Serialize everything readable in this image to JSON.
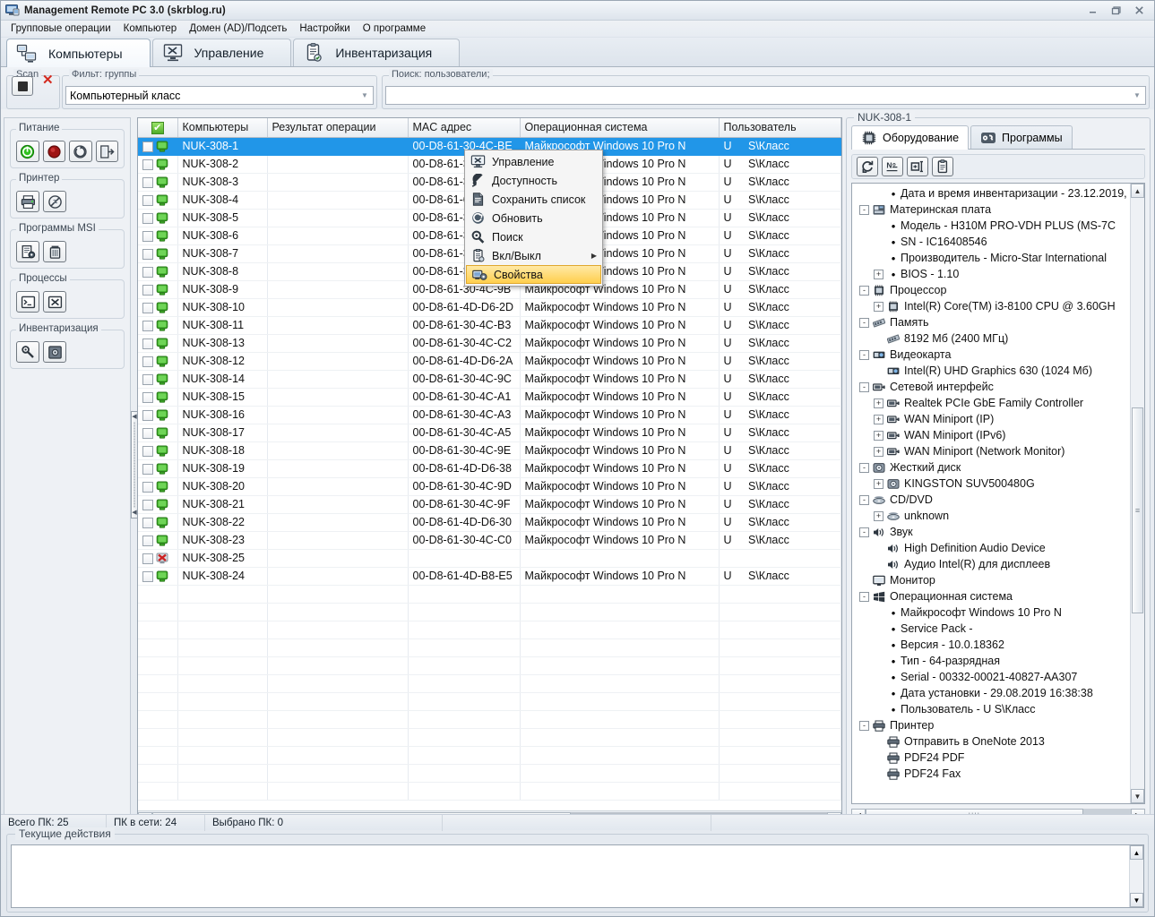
{
  "window": {
    "title": "Management Remote PC 3.0 (skrblog.ru)",
    "minimize": "–",
    "maximize": "❐",
    "close": "✕"
  },
  "menubar": [
    "Групповые операции",
    "Компьютер",
    "Домен (AD)/Подсеть",
    "Настройки",
    "О программе"
  ],
  "tabs": [
    {
      "label": "Компьютеры",
      "icon": "computers-icon",
      "active": true
    },
    {
      "label": "Управление",
      "icon": "management-icon",
      "active": false
    },
    {
      "label": "Инвентаризация",
      "icon": "inventory-icon",
      "active": false
    }
  ],
  "filterbar": {
    "scan_legend": "Scan",
    "filter_legend": "Фильт: группы",
    "filter_value": "Компьютерный класс",
    "search_legend": "Поиск: пользователи;",
    "search_value": ""
  },
  "lefttools": [
    {
      "legend": "Питание",
      "buttons": [
        {
          "name": "power-on-button",
          "icon": "power-green"
        },
        {
          "name": "power-off-button",
          "icon": "power-red"
        },
        {
          "name": "restart-button",
          "icon": "restart"
        },
        {
          "name": "logoff-button",
          "icon": "logoff"
        }
      ]
    },
    {
      "legend": "Принтер",
      "buttons": [
        {
          "name": "printer-add-button",
          "icon": "printer"
        },
        {
          "name": "printer-remove-button",
          "icon": "printer-block"
        }
      ]
    },
    {
      "legend": "Программы MSI",
      "buttons": [
        {
          "name": "msi-install-button",
          "icon": "msi-install"
        },
        {
          "name": "msi-uninstall-button",
          "icon": "trash"
        }
      ]
    },
    {
      "legend": "Процессы",
      "buttons": [
        {
          "name": "process-start-button",
          "icon": "console"
        },
        {
          "name": "process-kill-button",
          "icon": "console-kill"
        }
      ]
    },
    {
      "legend": "Инвентаризация",
      "buttons": [
        {
          "name": "inventory-scan-button",
          "icon": "wrench"
        },
        {
          "name": "inventory-save-button",
          "icon": "disk"
        }
      ]
    }
  ],
  "table": {
    "headers": [
      "",
      "Компьютеры",
      "Результат операции",
      "MAC адрес",
      "Операционная система",
      "Пользователь",
      ""
    ],
    "rows": [
      {
        "name": "NUK-308-1",
        "result": "",
        "mac": "00-D8-61-30-4C-BE",
        "os": "Майкрософт Windows 10 Pro N",
        "user": "U",
        "domain": "S\\Класс",
        "state": "on",
        "selected": true
      },
      {
        "name": "NUK-308-2",
        "result": "",
        "mac": "00-D8-61-30-4C-B1",
        "os": "Майкрософт Windows 10 Pro N",
        "user": "U",
        "domain": "S\\Класс",
        "state": "on",
        "selected": false
      },
      {
        "name": "NUK-308-3",
        "result": "",
        "mac": "00-D8-61-30-4C-A7",
        "os": "Майкрософт Windows 10 Pro N",
        "user": "U",
        "domain": "S\\Класс",
        "state": "on",
        "selected": false
      },
      {
        "name": "NUK-308-4",
        "result": "",
        "mac": "00-D8-61-61-4D-C4",
        "os": "Майкрософт Windows 10 Pro N",
        "user": "U",
        "domain": "S\\Класс",
        "state": "on",
        "selected": false
      },
      {
        "name": "NUK-308-5",
        "result": "",
        "mac": "00-D8-61-30-4C-A9",
        "os": "Майкрософт Windows 10 Pro N",
        "user": "U",
        "domain": "S\\Класс",
        "state": "on",
        "selected": false
      },
      {
        "name": "NUK-308-6",
        "result": "",
        "mac": "00-D8-61-30-4C-C1",
        "os": "Майкрософт Windows 10 Pro N",
        "user": "U",
        "domain": "S\\Класс",
        "state": "on",
        "selected": false
      },
      {
        "name": "NUK-308-7",
        "result": "",
        "mac": "00-D8-61-30-4C-B7",
        "os": "Майкрософт Windows 10 Pro N",
        "user": "U",
        "domain": "S\\Класс",
        "state": "on",
        "selected": false
      },
      {
        "name": "NUK-308-8",
        "result": "",
        "mac": "00-D8-61-30-4C-AD",
        "os": "Майкрософт Windows 10 Pro N",
        "user": "U",
        "domain": "S\\Класс",
        "state": "on",
        "selected": false
      },
      {
        "name": "NUK-308-9",
        "result": "",
        "mac": "00-D8-61-30-4C-9B",
        "os": "Майкрософт Windows 10 Pro N",
        "user": "U",
        "domain": "S\\Класс",
        "state": "on",
        "selected": false
      },
      {
        "name": "NUK-308-10",
        "result": "",
        "mac": "00-D8-61-4D-D6-2D",
        "os": "Майкрософт Windows 10 Pro N",
        "user": "U",
        "domain": "S\\Класс",
        "state": "on",
        "selected": false
      },
      {
        "name": "NUK-308-11",
        "result": "",
        "mac": "00-D8-61-30-4C-B3",
        "os": "Майкрософт Windows 10 Pro N",
        "user": "U",
        "domain": "S\\Класс",
        "state": "on",
        "selected": false
      },
      {
        "name": "NUK-308-13",
        "result": "",
        "mac": "00-D8-61-30-4C-C2",
        "os": "Майкрософт Windows 10 Pro N",
        "user": "U",
        "domain": "S\\Класс",
        "state": "on",
        "selected": false
      },
      {
        "name": "NUK-308-12",
        "result": "",
        "mac": "00-D8-61-4D-D6-2A",
        "os": "Майкрософт Windows 10 Pro N",
        "user": "U",
        "domain": "S\\Класс",
        "state": "on",
        "selected": false
      },
      {
        "name": "NUK-308-14",
        "result": "",
        "mac": "00-D8-61-30-4C-9C",
        "os": "Майкрософт Windows 10 Pro N",
        "user": "U",
        "domain": "S\\Класс",
        "state": "on",
        "selected": false
      },
      {
        "name": "NUK-308-15",
        "result": "",
        "mac": "00-D8-61-30-4C-A1",
        "os": "Майкрософт Windows 10 Pro N",
        "user": "U",
        "domain": "S\\Класс",
        "state": "on",
        "selected": false
      },
      {
        "name": "NUK-308-16",
        "result": "",
        "mac": "00-D8-61-30-4C-A3",
        "os": "Майкрософт Windows 10 Pro N",
        "user": "U",
        "domain": "S\\Класс",
        "state": "on",
        "selected": false
      },
      {
        "name": "NUK-308-17",
        "result": "",
        "mac": "00-D8-61-30-4C-A5",
        "os": "Майкрософт Windows 10 Pro N",
        "user": "U",
        "domain": "S\\Класс",
        "state": "on",
        "selected": false
      },
      {
        "name": "NUK-308-18",
        "result": "",
        "mac": "00-D8-61-30-4C-9E",
        "os": "Майкрософт Windows 10 Pro N",
        "user": "U",
        "domain": "S\\Класс",
        "state": "on",
        "selected": false
      },
      {
        "name": "NUK-308-19",
        "result": "",
        "mac": "00-D8-61-4D-D6-38",
        "os": "Майкрософт Windows 10 Pro N",
        "user": "U",
        "domain": "S\\Класс",
        "state": "on",
        "selected": false
      },
      {
        "name": "NUK-308-20",
        "result": "",
        "mac": "00-D8-61-30-4C-9D",
        "os": "Майкрософт Windows 10 Pro N",
        "user": "U",
        "domain": "S\\Класс",
        "state": "on",
        "selected": false
      },
      {
        "name": "NUK-308-21",
        "result": "",
        "mac": "00-D8-61-30-4C-9F",
        "os": "Майкрософт Windows 10 Pro N",
        "user": "U",
        "domain": "S\\Класс",
        "state": "on",
        "selected": false
      },
      {
        "name": "NUK-308-22",
        "result": "",
        "mac": "00-D8-61-4D-D6-30",
        "os": "Майкрософт Windows 10 Pro N",
        "user": "U",
        "domain": "S\\Класс",
        "state": "on",
        "selected": false
      },
      {
        "name": "NUK-308-23",
        "result": "",
        "mac": "00-D8-61-30-4C-C0",
        "os": "Майкрософт Windows 10 Pro N",
        "user": "U",
        "domain": "S\\Класс",
        "state": "on",
        "selected": false
      },
      {
        "name": "NUK-308-25",
        "result": "",
        "mac": "",
        "os": "",
        "user": "",
        "domain": "",
        "state": "off",
        "selected": false
      },
      {
        "name": "NUK-308-24",
        "result": "",
        "mac": "00-D8-61-4D-B8-E5",
        "os": "Майкрософт Windows 10 Pro N",
        "user": "U",
        "domain": "S\\Класс",
        "state": "on",
        "selected": false
      }
    ]
  },
  "contextmenu": [
    {
      "label": "Управление",
      "icon": "management-icon",
      "highlight": false,
      "submenu": false
    },
    {
      "label": "Доступность",
      "icon": "ping-icon",
      "highlight": false,
      "submenu": false
    },
    {
      "label": "Сохранить список",
      "icon": "save-list-icon",
      "highlight": false,
      "submenu": false
    },
    {
      "label": "Обновить",
      "icon": "refresh-icon",
      "highlight": false,
      "submenu": false
    },
    {
      "label": "Поиск",
      "icon": "search-icon",
      "highlight": false,
      "submenu": false
    },
    {
      "label": "Вкл/Выкл",
      "icon": "clipboard-icon",
      "highlight": false,
      "submenu": true
    },
    {
      "label": "Свойства",
      "icon": "properties-icon",
      "highlight": true,
      "submenu": false
    }
  ],
  "rightpanel": {
    "legend": "NUK-308-1",
    "tabs": [
      {
        "label": "Оборудование",
        "icon": "cpu-chip-icon",
        "active": true
      },
      {
        "label": "Программы",
        "icon": "programs-icon",
        "active": false
      }
    ],
    "toolbar": [
      {
        "name": "refresh-inventory-button",
        "icon": "refresh-icon"
      },
      {
        "name": "number-button",
        "icon": "number-icon"
      },
      {
        "name": "rename-button",
        "icon": "rename-icon"
      },
      {
        "name": "copy-clipboard-button",
        "icon": "clipboard-icon"
      }
    ],
    "tree": [
      {
        "level": 1,
        "exp": "",
        "icon": "bullet",
        "label": "Дата и время инвентаризации - 23.12.2019,"
      },
      {
        "level": 0,
        "exp": "-",
        "icon": "motherboard",
        "label": "Материнская плата"
      },
      {
        "level": 1,
        "exp": "",
        "icon": "bullet",
        "label": "Модель - H310M PRO-VDH PLUS (MS-7C"
      },
      {
        "level": 1,
        "exp": "",
        "icon": "bullet",
        "label": "SN - IC16408546"
      },
      {
        "level": 1,
        "exp": "",
        "icon": "bullet",
        "label": "Производитель - Micro-Star International"
      },
      {
        "level": 1,
        "exp": "+",
        "icon": "bullet",
        "label": "BIOS - 1.10"
      },
      {
        "level": 0,
        "exp": "-",
        "icon": "cpu",
        "label": "Процессор"
      },
      {
        "level": 1,
        "exp": "+",
        "icon": "cpu",
        "label": "Intel(R) Core(TM) i3-8100 CPU @ 3.60GH"
      },
      {
        "level": 0,
        "exp": "-",
        "icon": "ram",
        "label": "Память"
      },
      {
        "level": 1,
        "exp": "",
        "icon": "ram",
        "label": "8192 Мб (2400 МГц)"
      },
      {
        "level": 0,
        "exp": "-",
        "icon": "gpu",
        "label": "Видеокарта"
      },
      {
        "level": 1,
        "exp": "",
        "icon": "gpu",
        "label": "Intel(R) UHD Graphics 630 (1024 Мб)"
      },
      {
        "level": 0,
        "exp": "-",
        "icon": "nic",
        "label": "Сетевой интерфейс"
      },
      {
        "level": 1,
        "exp": "+",
        "icon": "nic",
        "label": "Realtek PCIe GbE Family Controller"
      },
      {
        "level": 1,
        "exp": "+",
        "icon": "nic",
        "label": "WAN Miniport (IP)"
      },
      {
        "level": 1,
        "exp": "+",
        "icon": "nic",
        "label": "WAN Miniport (IPv6)"
      },
      {
        "level": 1,
        "exp": "+",
        "icon": "nic",
        "label": "WAN Miniport (Network Monitor)"
      },
      {
        "level": 0,
        "exp": "-",
        "icon": "hdd",
        "label": "Жесткий диск"
      },
      {
        "level": 1,
        "exp": "+",
        "icon": "hdd",
        "label": "KINGSTON SUV500480G"
      },
      {
        "level": 0,
        "exp": "-",
        "icon": "cd",
        "label": "CD/DVD"
      },
      {
        "level": 1,
        "exp": "+",
        "icon": "cd",
        "label": "unknown"
      },
      {
        "level": 0,
        "exp": "-",
        "icon": "sound",
        "label": "Звук"
      },
      {
        "level": 1,
        "exp": "",
        "icon": "sound",
        "label": "High Definition Audio Device"
      },
      {
        "level": 1,
        "exp": "",
        "icon": "sound",
        "label": "Аудио Intel(R) для дисплеев"
      },
      {
        "level": 0,
        "exp": "",
        "icon": "monitor",
        "label": "Монитор"
      },
      {
        "level": 0,
        "exp": "-",
        "icon": "windows",
        "label": "Операционная система"
      },
      {
        "level": 1,
        "exp": "",
        "icon": "bullet",
        "label": "Майкрософт Windows 10 Pro N"
      },
      {
        "level": 1,
        "exp": "",
        "icon": "bullet",
        "label": "Service Pack -"
      },
      {
        "level": 1,
        "exp": "",
        "icon": "bullet",
        "label": "Версия - 10.0.18362"
      },
      {
        "level": 1,
        "exp": "",
        "icon": "bullet",
        "label": "Тип - 64-разрядная"
      },
      {
        "level": 1,
        "exp": "",
        "icon": "bullet",
        "label": "Serial - 00332-00021-40827-AA307"
      },
      {
        "level": 1,
        "exp": "",
        "icon": "bullet",
        "label": "Дата установки - 29.08.2019 16:38:38"
      },
      {
        "level": 1,
        "exp": "",
        "icon": "bullet",
        "label": "Пользователь - U       S\\Класс"
      },
      {
        "level": 0,
        "exp": "-",
        "icon": "printer",
        "label": "Принтер"
      },
      {
        "level": 1,
        "exp": "",
        "icon": "printer",
        "label": "Отправить в OneNote 2013"
      },
      {
        "level": 1,
        "exp": "",
        "icon": "printer",
        "label": "PDF24 PDF"
      },
      {
        "level": 1,
        "exp": "",
        "icon": "printer",
        "label": "PDF24 Fax"
      }
    ]
  },
  "statusbar": [
    {
      "name": "total-pc",
      "text": "Всего ПК: 25"
    },
    {
      "name": "online-pc",
      "text": "ПК в сети: 24"
    },
    {
      "name": "selected-pc",
      "text": "Выбрано ПК: 0"
    }
  ],
  "logpanel": {
    "legend": "Текущие действия",
    "content": ""
  },
  "colors": {
    "selection": "#2196e8",
    "menu_highlight": "#ffcf4d",
    "status_on": "#3fae28",
    "status_off": "#cc2222"
  }
}
